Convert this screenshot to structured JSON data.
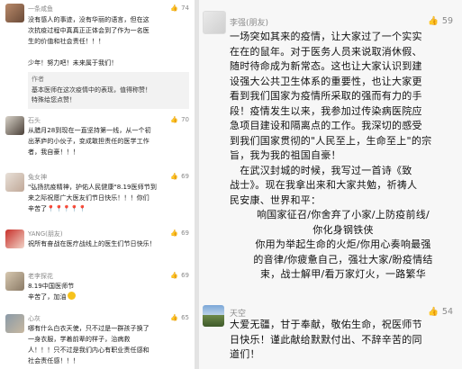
{
  "left_comments": [
    {
      "name": "一条咸鱼",
      "likes": "74",
      "lines": [
        "没有感人的事迹，没有华丽的语言，但在这",
        "次抗疫过程中真真正正体会到了作为一名医",
        "生的价值和社会责任！！！",
        "",
        "少年！努力吧！未来属于我们！"
      ],
      "reply_label": "作者",
      "reply_lines": [
        "基本医师在这次疫情中的表现，值得称赞！",
        "特殊给您点赞！"
      ]
    },
    {
      "name": "石头",
      "likes": "70",
      "lines": [
        "从腊月28到现在一直坚持第一线，从一个初",
        "出茅庐的小伙子，变成敢担责任的医学工作",
        "者，我自豪！！！"
      ]
    },
    {
      "name": "兔女神",
      "likes": "69",
      "lines": [
        "\"弘扬抗疫精神，护佑人民健康\"8.19医师节到",
        "来之际祝愿广大医友们节日快乐！！！你们",
        "辛苦了"
      ]
    },
    {
      "name": "YANG(朋友)",
      "likes": "69",
      "lines": [
        "祝所有奋战在医疗战线上的医生们节日快乐！"
      ]
    },
    {
      "name": "老李探花",
      "likes": "69",
      "lines": [
        "8.19中国医师节",
        "辛苦了，加油"
      ]
    },
    {
      "name": "心灰",
      "likes": "65",
      "lines": [
        "哪有什么白衣天使，只不过是一群孩子换了",
        "一身衣服，学着前辈的样子，治病救",
        "人！！！只不过是我们内心有职业责任感和",
        "社会责任感！！！"
      ]
    }
  ],
  "right_comments": [
    {
      "name": "李强(朋友)",
      "likes": "59",
      "lines": [
        "一场突如其来的疫情，让大家过了一个实实",
        "在在的鼠年。对于医务人员来说取消休假、",
        "随时待命成为新常态。这也让大家认识到建",
        "设强大公共卫生体系的重要性，也让大家更",
        "看到我们国家为疫情所采取的强而有力的手",
        "段！疫情发生以来，我参加过传染病医院应",
        "急项目建设和隔离点的工作。我深切的感受",
        "到我们国家贯彻的\"人民至上，生命至上\"的宗",
        "旨，我为我的祖国自豪！",
        "　在武汉封城的时候，我写过一首诗《致",
        "战士》。现在我拿出来和大家共勉，祈祷人",
        "民安康、世界和平："
      ],
      "poem": [
        "响国家征召/你舍弃了小家/上防疫前线/",
        "你化身钢铁侠",
        "你用为举起生命的火炬/你用心奏响最强",
        "的音律/你疲惫自己，强壮大家/盼疫情结",
        "束，战士解甲/看万家灯火，一路繁华"
      ]
    },
    {
      "name": "天空",
      "likes": "54",
      "lines": [
        "大爱无疆，甘于奉献，敬佑生命，祝医师节",
        "日快乐！谨此献给默默付出、不辞辛苦的同",
        "道们！"
      ]
    }
  ],
  "icons": {
    "like": "thumbs-up-icon",
    "pin": "pushpin-icon",
    "smile": "smile-emoji-icon"
  }
}
